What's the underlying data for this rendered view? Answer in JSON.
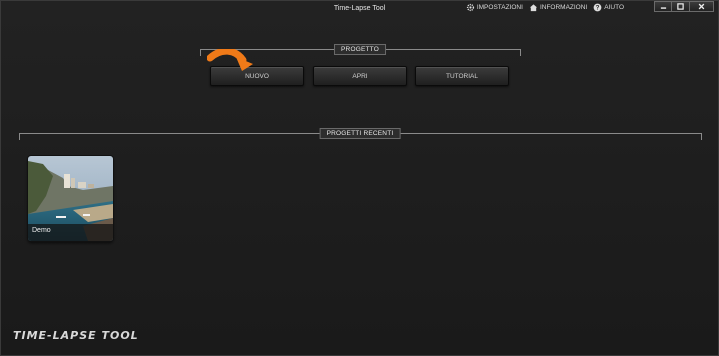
{
  "window": {
    "title": "Time-Lapse Tool"
  },
  "top_menu": {
    "settings_label": "IMPOSTAZIONI",
    "info_label": "INFORMAZIONI",
    "help_label": "AIUTO"
  },
  "project_section": {
    "label": "PROGETTO",
    "buttons": {
      "new": "NUOVO",
      "open": "APRI",
      "tutorial": "TUTORIAL"
    }
  },
  "recent_section": {
    "label": "PROGETTI RECENTI",
    "projects": [
      {
        "name": "Demo"
      }
    ]
  },
  "footer": {
    "logo_text": "TIME-LAPSE TOOL"
  },
  "colors": {
    "accent": "#f07a18",
    "background": "#1d1d1d",
    "button_text": "#d0d0d0"
  },
  "icons": [
    "gear-icon",
    "house-icon",
    "help-icon",
    "minimize-icon",
    "maximize-icon",
    "close-icon",
    "arrow-icon"
  ]
}
